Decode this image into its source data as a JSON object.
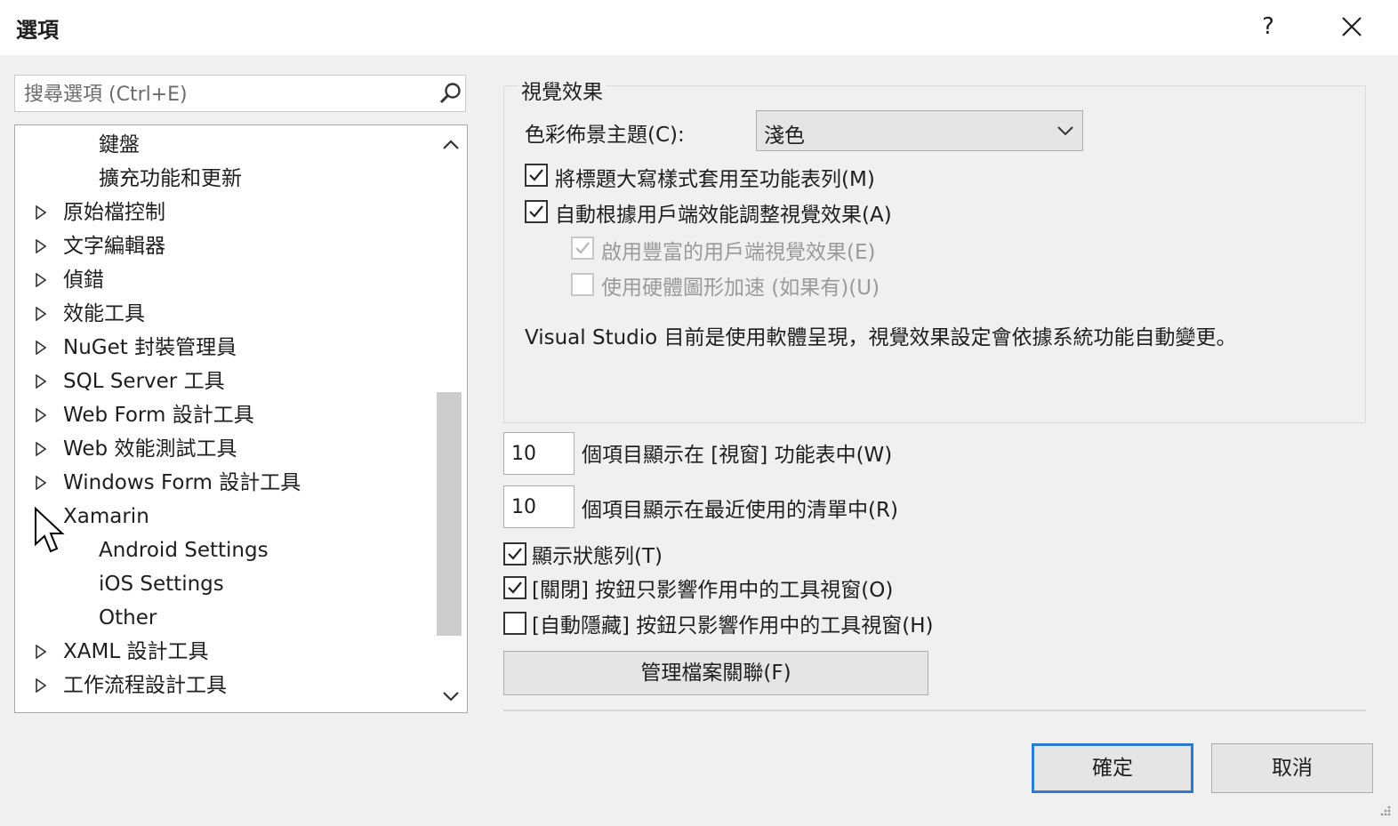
{
  "window": {
    "title": "選項",
    "help_label": "?"
  },
  "search": {
    "placeholder": "搜尋選項 (Ctrl+E)"
  },
  "tree": {
    "items": [
      {
        "label": "鍵盤",
        "has_arrow": false
      },
      {
        "label": "擴充功能和更新",
        "has_arrow": false
      },
      {
        "label": "原始檔控制",
        "has_arrow": true
      },
      {
        "label": "文字編輯器",
        "has_arrow": true
      },
      {
        "label": "偵錯",
        "has_arrow": true
      },
      {
        "label": "效能工具",
        "has_arrow": true
      },
      {
        "label": "NuGet 封裝管理員",
        "has_arrow": true
      },
      {
        "label": "SQL Server 工具",
        "has_arrow": true
      },
      {
        "label": "Web Form 設計工具",
        "has_arrow": true
      },
      {
        "label": "Web 效能測試工具",
        "has_arrow": true
      },
      {
        "label": "Windows Form 設計工具",
        "has_arrow": true
      },
      {
        "label": "Xamarin",
        "has_arrow": true,
        "expanded": true
      },
      {
        "label": "Android Settings",
        "has_arrow": false
      },
      {
        "label": "iOS Settings",
        "has_arrow": false
      },
      {
        "label": "Other",
        "has_arrow": false
      },
      {
        "label": "XAML 設計工具",
        "has_arrow": true
      },
      {
        "label": "工作流程設計工具",
        "has_arrow": true
      }
    ]
  },
  "visual": {
    "group_title": "視覺效果",
    "theme_label": "色彩佈景主題(C):",
    "theme_value": "淺色",
    "cb_title_case": {
      "label": "將標題大寫樣式套用至功能表列(M)",
      "checked": true
    },
    "cb_auto_adjust": {
      "label": "自動根據用戶端效能調整視覺效果(A)",
      "checked": true
    },
    "cb_rich_client": {
      "label": "啟用豐富的用戶端視覺效果(E)",
      "checked": true,
      "disabled": true
    },
    "cb_hw_accel": {
      "label": "使用硬體圖形加速 (如果有)(U)",
      "checked": false,
      "disabled": true
    },
    "info_text": "Visual Studio 目前是使用軟體呈現，視覺效果設定會依據系統功能自動變更。"
  },
  "general": {
    "window_menu_count": "10",
    "window_menu_label": "個項目顯示在 [視窗] 功能表中(W)",
    "recent_count": "10",
    "recent_label": "個項目顯示在最近使用的清單中(R)",
    "cb_status_bar": {
      "label": "顯示狀態列(T)",
      "checked": true
    },
    "cb_close_button": {
      "label": "[關閉] 按鈕只影響作用中的工具視窗(O)",
      "checked": true
    },
    "cb_autohide_button": {
      "label": "[自動隱藏] 按鈕只影響作用中的工具視窗(H)",
      "checked": false
    },
    "file_assoc_button": "管理檔案關聯(F)"
  },
  "footer": {
    "ok_label": "確定",
    "cancel_label": "取消"
  },
  "colors": {
    "accent": "#2e7ad1",
    "background": "#f0f0f0"
  }
}
